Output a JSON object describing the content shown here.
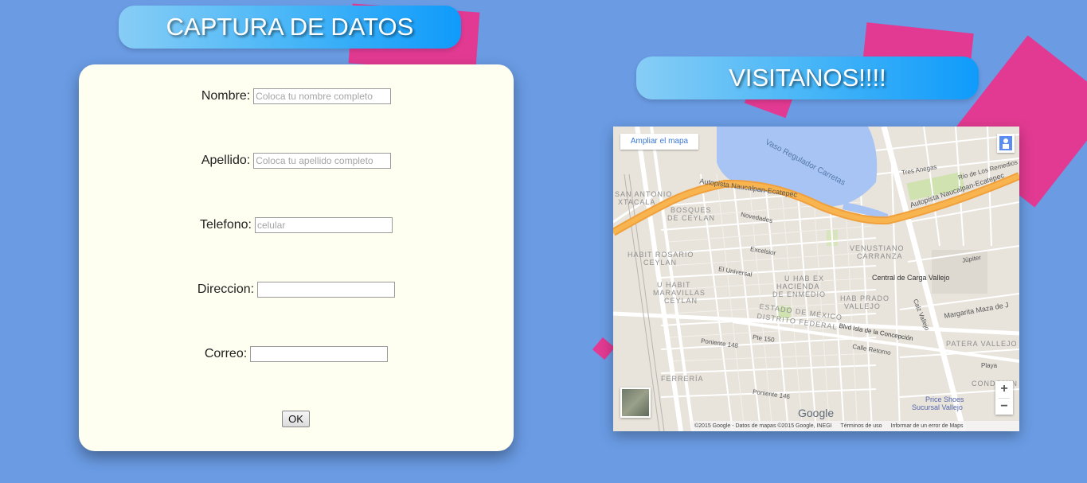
{
  "form": {
    "title": "CAPTURA DE DATOS",
    "fields": [
      {
        "label": "Nombre:",
        "placeholder": "Coloca tu nombre completo"
      },
      {
        "label": "Apellido:",
        "placeholder": "Coloca tu apellido completo"
      },
      {
        "label": "Telefono:",
        "placeholder": "celular"
      },
      {
        "label": "Direccion:",
        "placeholder": ""
      },
      {
        "label": "Correo:",
        "placeholder": ""
      }
    ],
    "submit_label": "OK"
  },
  "map_section": {
    "title": "VISITANOS!!!!",
    "enlarge_label": "Ampliar el mapa",
    "google_logo": "Google",
    "zoom_in": "+",
    "zoom_out": "−",
    "attribution": {
      "copyright": "©2015 Google - Datos de mapas ©2015 Google, INEGI",
      "terms": "Términos de uso",
      "report": "Informar de un error de Maps"
    },
    "labels": {
      "vaso": "Vaso Regulador Carretas",
      "autopista_left": "Autopista Naucalpan-Ecatepec",
      "autopista_right": "Autopista Naucalpan-Ecatepec",
      "san_antonio": "SAN ANTONIO",
      "xtacala": "XTACALA",
      "bosques": "BOSQUES",
      "de_ceylan": "DE CEYLAN",
      "novedades": "Novedades",
      "habit_rosario": "HABIT ROSARIO",
      "ceylan": "CEYLAN",
      "excelsior": "Excelsior",
      "venustiano": "VENUSTIANO",
      "carranza": "CARRANZA",
      "jupiter": "Júpiter",
      "central_carga": "Central de Carga Vallejo",
      "el_universal": "El Universal",
      "u_hab_ex": "U HAB EX",
      "hacienda": "HACIENDA",
      "de_enmedio": "DE ENMEDIO",
      "u_habit": "U HABIT",
      "maravillas": "MARAVILLAS",
      "ceylan2": "CEYLAN",
      "hab_prado": "HAB PRADO",
      "vallejo": "VALLEJO",
      "estado_mexico": "ESTADO DE MÉXICO",
      "distrito_federal": "DISTRITO FEDERAL",
      "margarita": "Margarita Maza de J",
      "blvd_isla": "Blvd Isla de la Concepción",
      "calle_retorno": "Calle Retorno",
      "patera": "PATERA VALLEJO",
      "poniente148": "Poniente 148",
      "poniente146": "Poniente 146",
      "ferreria": "FERRERÍA",
      "playa": "Playa",
      "pte150": "Pte 150",
      "price_shoes": "Price Shoes",
      "sucursal": "Sucursal Vallejo",
      "condominio": "CONDOMIN",
      "tres_anegas": "Tres Anegas",
      "rio_remedios": "Río de Los Remedios",
      "calz_vallejo": "Calz Vallejo"
    }
  }
}
